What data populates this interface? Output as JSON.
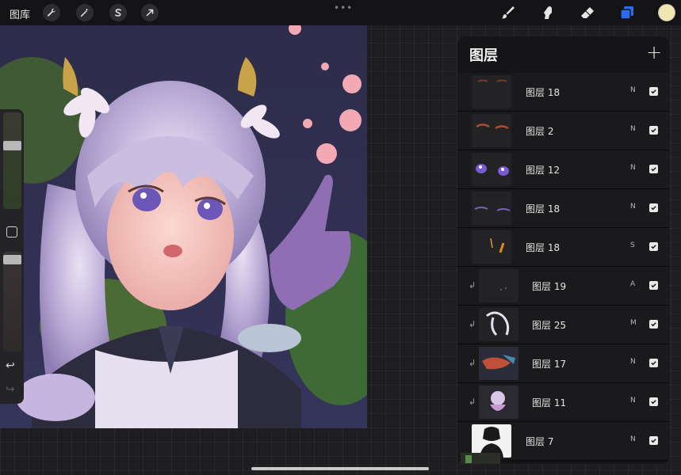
{
  "topbar": {
    "gallery_label": "图库",
    "tools_left": [
      {
        "name": "actions",
        "icon": "wrench-icon"
      },
      {
        "name": "adjustments",
        "icon": "magic-wand-icon"
      },
      {
        "name": "selection",
        "icon": "selection-s-icon"
      },
      {
        "name": "transform",
        "icon": "arrow-cursor-icon"
      }
    ],
    "drag_handle": "•••",
    "tools_right": [
      {
        "name": "brush",
        "icon": "brush-icon"
      },
      {
        "name": "smudge",
        "icon": "smudge-finger-icon"
      },
      {
        "name": "eraser",
        "icon": "eraser-icon"
      },
      {
        "name": "layers",
        "icon": "layers-icon",
        "active": true,
        "color": "#2b6cf0"
      }
    ],
    "current_color": "#f0e6b4"
  },
  "sidebar": {
    "brush_size_level": 0.32,
    "opacity_level": 0.14,
    "undo_glyph": "↩",
    "redo_glyph": "↪"
  },
  "layers_panel": {
    "title": "图层",
    "add_glyph": "+",
    "layers": [
      {
        "name": "图层 18",
        "blend": "N",
        "visible": true,
        "clipped": false
      },
      {
        "name": "图层 2",
        "blend": "N",
        "visible": true,
        "clipped": false
      },
      {
        "name": "图层 12",
        "blend": "N",
        "visible": true,
        "clipped": false
      },
      {
        "name": "图层 18",
        "blend": "N",
        "visible": true,
        "clipped": false
      },
      {
        "name": "图层 18",
        "blend": "S",
        "visible": true,
        "clipped": false
      },
      {
        "name": "图层 19",
        "blend": "A",
        "visible": true,
        "clipped": true
      },
      {
        "name": "图层 25",
        "blend": "M",
        "visible": true,
        "clipped": true
      },
      {
        "name": "图层 17",
        "blend": "N",
        "visible": true,
        "clipped": true
      },
      {
        "name": "图层 11",
        "blend": "N",
        "visible": true,
        "clipped": true
      },
      {
        "name": "图层 7",
        "blend": "N",
        "visible": true,
        "clipped": false
      }
    ]
  }
}
